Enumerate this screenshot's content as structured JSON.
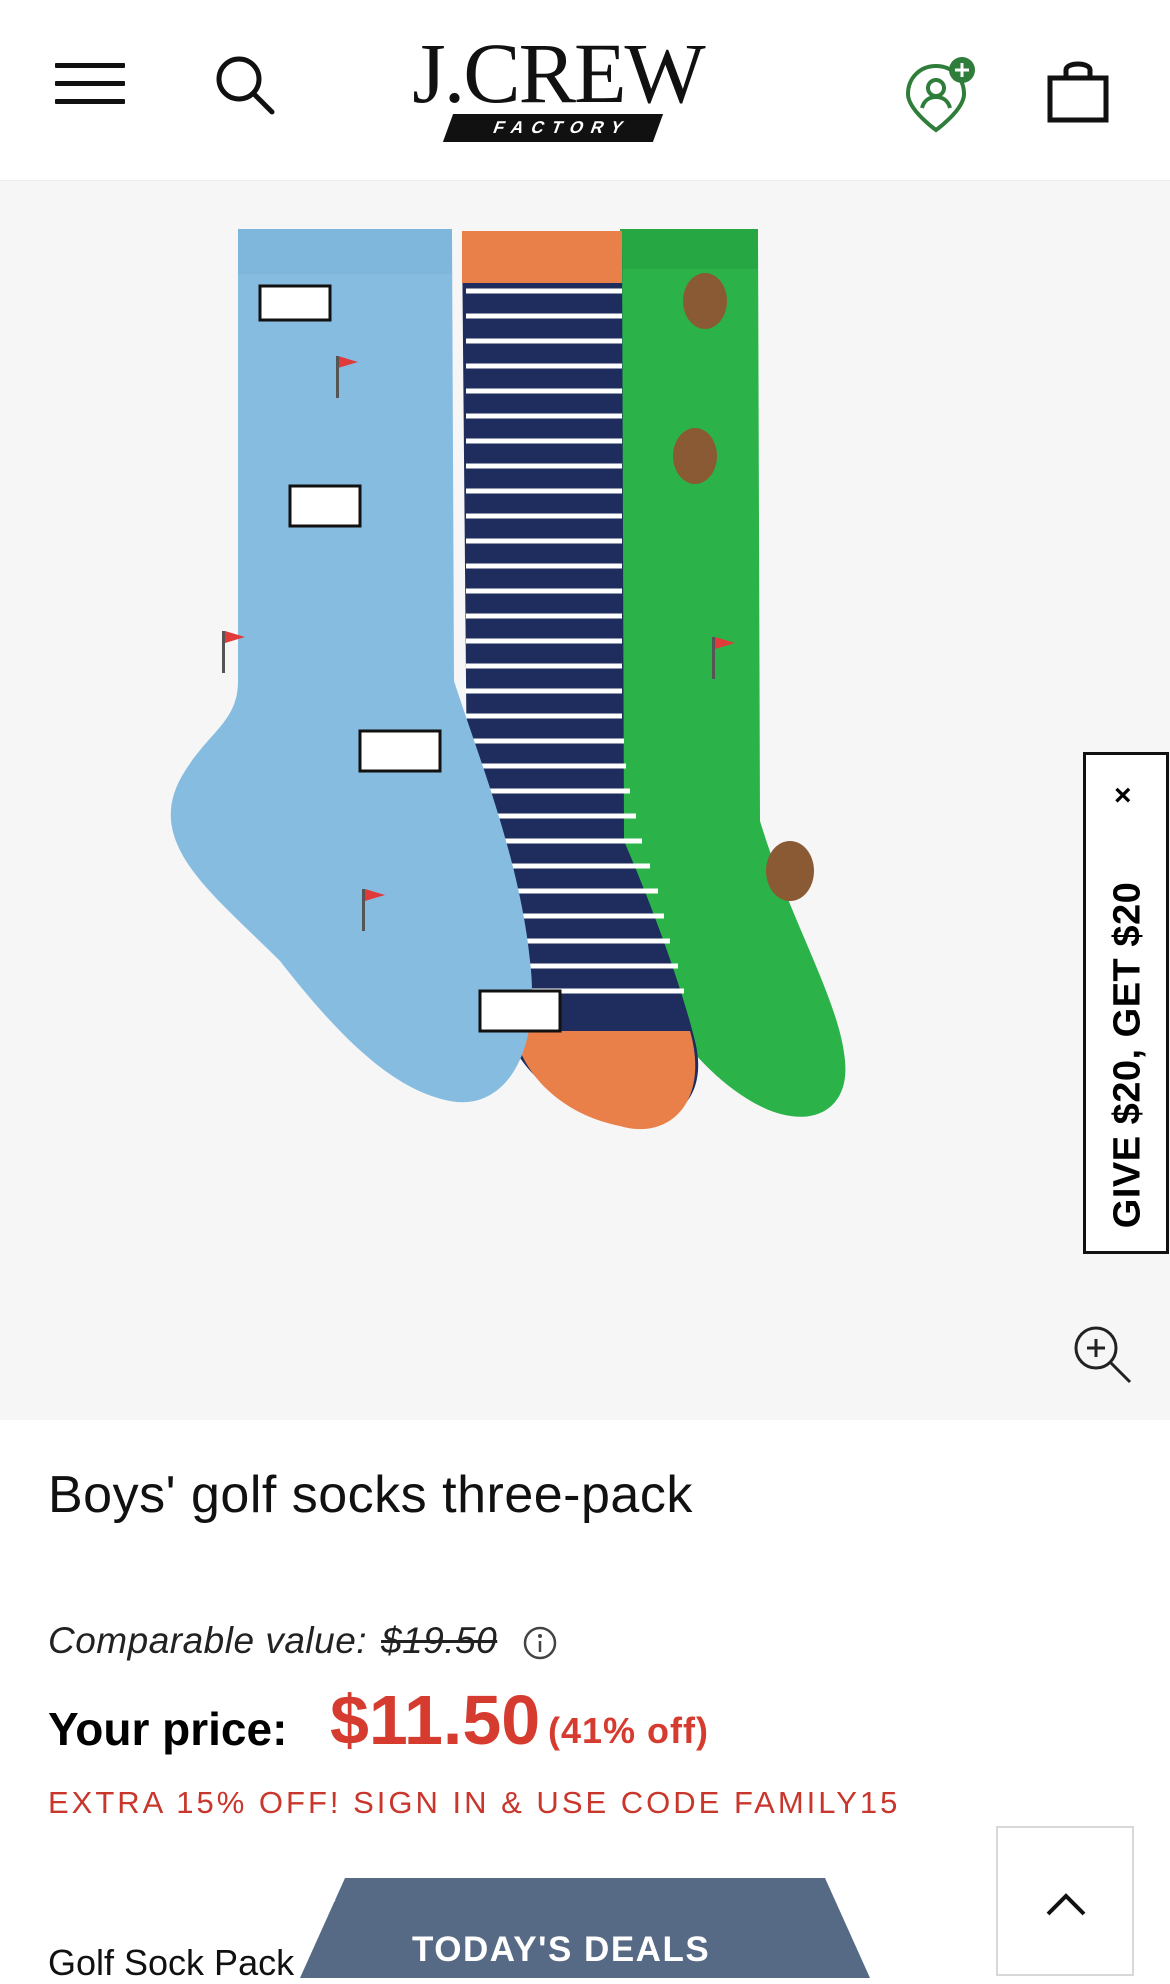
{
  "header": {
    "logo_main": "J.CREW",
    "logo_sub": "FACTORY",
    "icons": [
      "menu-icon",
      "search-icon",
      "store-locator-icon",
      "shopping-bag-icon"
    ]
  },
  "product": {
    "title": "Boys' golf socks three-pack",
    "comparable_label": "Comparable value:",
    "comparable_price": "$19.50",
    "your_price_label": "Your price:",
    "price": "$11.50",
    "discount": "(41% off)",
    "extra_promo": "EXTRA 15% OFF! SIGN IN & USE CODE FAMILY15",
    "variant_label": "Golf Sock Pack"
  },
  "promo_tab": {
    "close": "×",
    "text": "GIVE $20, GET $20"
  },
  "deals_button": {
    "label": "TODAY'S DEALS"
  },
  "colors": {
    "price_red": "#d63b2f",
    "deals_bg": "#566985",
    "hero_bg": "#f6f6f6",
    "store_icon_green": "#2f7d3a"
  }
}
